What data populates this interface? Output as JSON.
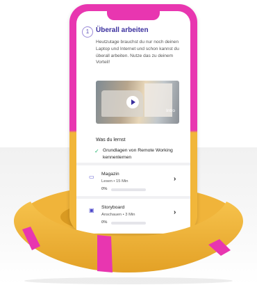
{
  "module": {
    "step_number": "1",
    "title": "Überall arbeiten",
    "description": "Heutzutage brauchst du nur noch deinen Laptop und Internet und schon kannst du überall arbeiten. Nutze das zu deinem Vorteil!",
    "video_label": "Intro"
  },
  "learn": {
    "heading": "Was du lernst",
    "items": [
      "Grundlagen von Remote Working kennenlernen"
    ]
  },
  "cards": [
    {
      "title": "Magazin",
      "meta": "Lesen • 15 Min",
      "progress_label": "0%",
      "progress": 0,
      "icon": "magazine-icon"
    },
    {
      "title": "Storyboard",
      "meta": "Anschauen • 3 Min",
      "progress_label": "0%",
      "progress": 0,
      "icon": "storyboard-icon"
    }
  ],
  "colors": {
    "accent": "#3a2f9e",
    "magenta": "#e836b0",
    "yellow": "#f1b63a",
    "check": "#20b26b"
  }
}
